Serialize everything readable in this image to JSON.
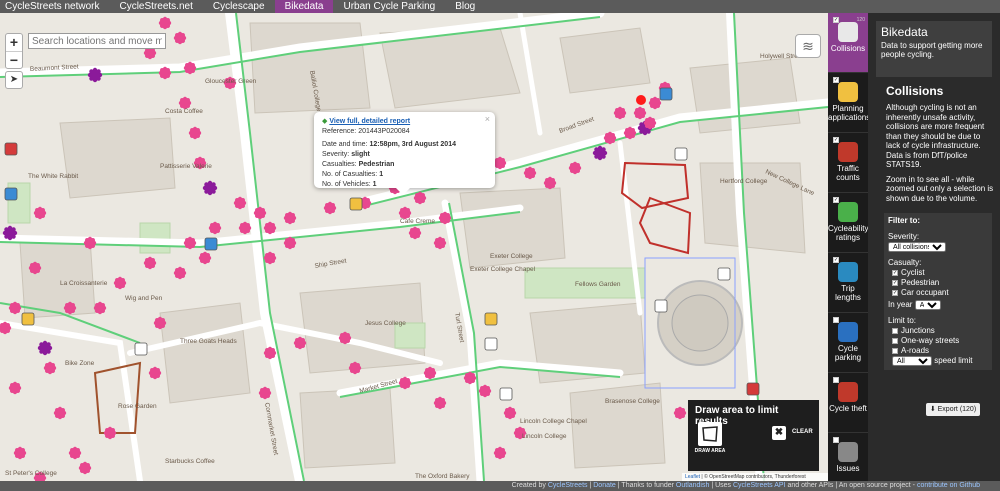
{
  "nav": {
    "items": [
      "CycleStreets network",
      "CycleStreets.net",
      "Cyclescape",
      "Bikedata",
      "Urban Cycle Parking",
      "Blog"
    ],
    "active_index": 3
  },
  "map": {
    "search_placeholder": "Search locations and move map",
    "zoom_in": "+",
    "zoom_out": "−",
    "street_labels": [
      "Beaumont Street",
      "Costa Coffee",
      "Balliol College",
      "Broad Street",
      "Holywell Street",
      "The White Rabbit",
      "Pattisserie Valerie",
      "Gloucester Green",
      "Exeter College",
      "Hertford College",
      "Jesus College",
      "Fellows Garden",
      "Ship Street",
      "Cornmarket Street",
      "Turl Street",
      "Market Street",
      "Lincoln College",
      "Brasenose College",
      "Three Goats Heads",
      "St Peter's College",
      "Rose Garden",
      "Wig and Pen",
      "Starbucks Coffee",
      "The Oxford Bakery",
      "La Croissanterie",
      "Cafe Creme",
      "Lincoln College Chapel",
      "Exeter College Chapel",
      "Bike Zone",
      "New College Lane"
    ]
  },
  "popup": {
    "link": "View full, detailed report",
    "close": "×",
    "reference_label": "Reference:",
    "reference": "201443P020084",
    "datetime_label": "Date and time:",
    "datetime": "12:58pm, 3rd August 2014",
    "severity_label": "Severity:",
    "severity": "slight",
    "casualties_label": "Casualties:",
    "casualties": "Pedestrian",
    "num_casualties_label": "No. of Casualties:",
    "num_casualties": "1",
    "num_vehicles_label": "No. of Vehicles:",
    "num_vehicles": "1"
  },
  "draw": {
    "title": "Draw area to limit results",
    "draw_label": "DRAW AREA",
    "clear_label": "CLEAR"
  },
  "attribution": {
    "leaflet": "Leaflet",
    "text": " | © OpenStreetMap contributors, Thunderforest"
  },
  "layer_tabs": [
    {
      "label": "Collisions",
      "count": "120",
      "checked": true,
      "active": true,
      "icon": "collision-icon",
      "color": "#e8e8e8"
    },
    {
      "label": "Planning applications",
      "count": "",
      "checked": true,
      "active": false,
      "icon": "planning-icon",
      "color": "#f0c040"
    },
    {
      "label": "Traffic counts",
      "count": "",
      "checked": true,
      "active": false,
      "icon": "traffic-count-icon",
      "color": "#c0392b"
    },
    {
      "label": "Cycleability ratings",
      "count": "",
      "checked": true,
      "active": false,
      "icon": "cycleability-icon",
      "color": "#4ab04a"
    },
    {
      "label": "Trip lengths",
      "count": "",
      "checked": true,
      "active": false,
      "icon": "trip-lengths-icon",
      "color": "#2a8ac0"
    },
    {
      "label": "Cycle parking",
      "count": "",
      "checked": false,
      "active": false,
      "icon": "cycle-parking-icon",
      "color": "#2a70c0"
    },
    {
      "label": "Cycle theft",
      "count": "",
      "checked": false,
      "active": false,
      "icon": "cycle-theft-icon",
      "color": "#c0392b"
    },
    {
      "label": "Issues",
      "count": "",
      "checked": false,
      "active": false,
      "icon": "issues-icon",
      "color": "#888888"
    }
  ],
  "panel": {
    "title": "Bikedata",
    "desc": "Data to support getting more people cycling.",
    "heading": "Collisions",
    "para1": "Although cycling is not an inherently unsafe activity, collisions are more frequent than they should be due to lack of cycle infrastructure. Data is from DfT/police STATS19.",
    "para2": "Zoom in to see all - while zoomed out only a selection is shown due to the volume.",
    "filter_title": "Filter to:",
    "severity_label": "Severity:",
    "severity_value": "All collisions",
    "casualty_label": "Casualty:",
    "casualty_options": [
      "Cyclist",
      "Pedestrian",
      "Car occupant"
    ],
    "year_label": "In year",
    "year_value": "All",
    "limit_label": "Limit to:",
    "limit_options": [
      "Junctions",
      "One-way streets",
      "A-roads"
    ],
    "speed_value": "All",
    "speed_label": "speed limit",
    "export_label": "Export (120)"
  },
  "footer": {
    "text1": "Created by ",
    "cyclestreets": "CycleStreets",
    "donate": "Donate",
    "thanks": "Thanks to funder ",
    "outlandish": "Outlandish",
    "uses": "Uses ",
    "api": "CycleStreets API",
    "other": " and other APIs",
    "oss": "An open source project - ",
    "github": "contribute on Github"
  },
  "colors": {
    "accent": "#8a3f8f",
    "collision_pink": "#e8478f",
    "collision_purple": "#8b1a9a",
    "route_green": "#5fcf7a"
  }
}
